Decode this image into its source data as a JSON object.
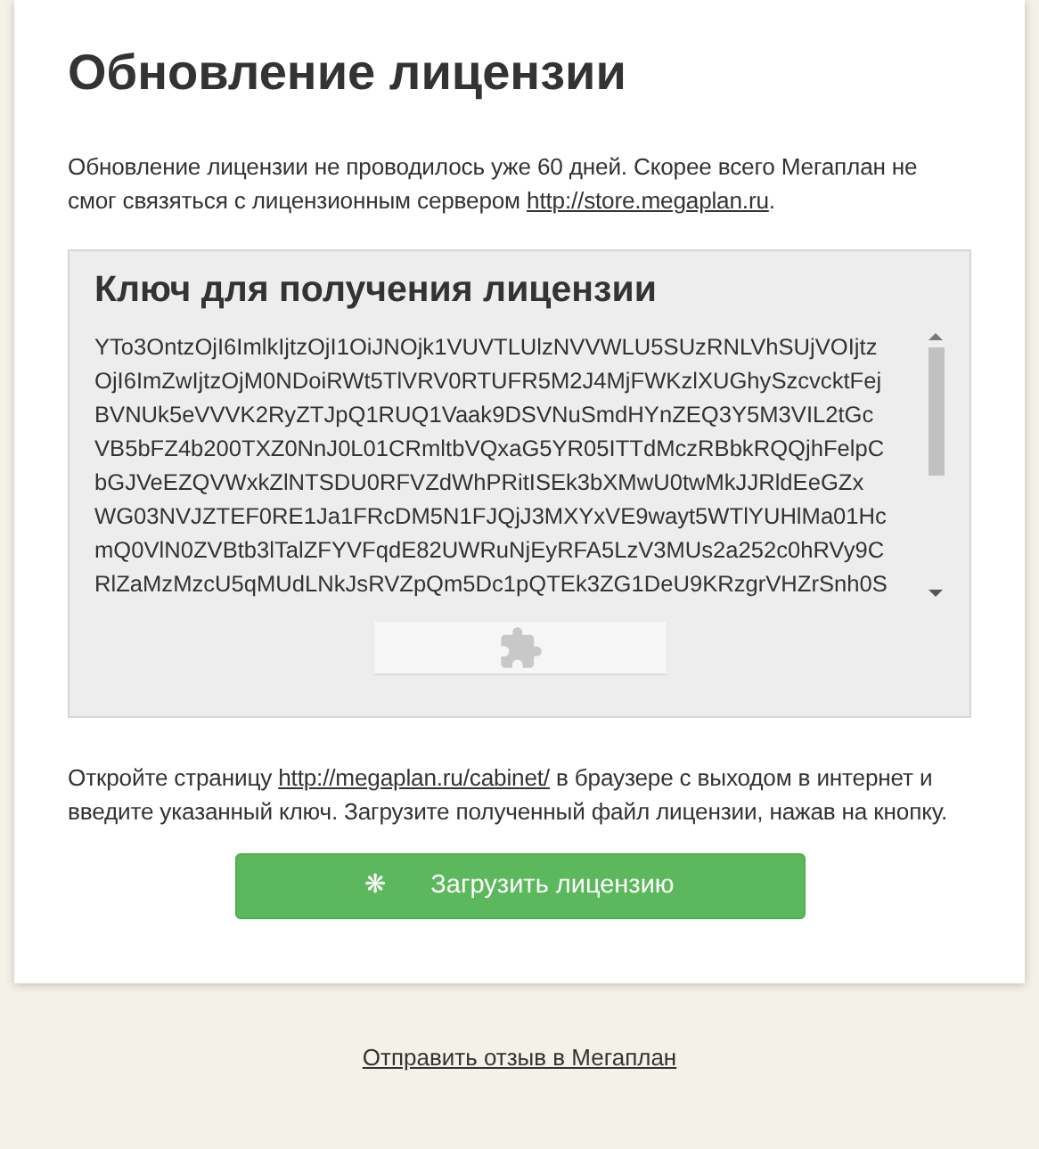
{
  "title": "Обновление лицензии",
  "intro": {
    "text": "Обновление лицензии не проводилось уже 60 дней. Скорее всего Мегаплан не смог связяться с лицензионным сервером ",
    "link": "http://store.megaplan.ru",
    "after": "."
  },
  "key_panel": {
    "heading": "Ключ для получения лицензии",
    "key_lines": [
      "YTo3OntzOjI6ImlkIjtzOjI1OiJNOjk1VUVTLUlzNVVWLU5SUzRNLVhSUjVOIjtz",
      "OjI6ImZwIjtzOjM0NDoiRWt5TlVRV0RTUFR5M2J4MjFWKzlXUGhySzcvcktFej",
      "BVNUk5eVVVK2RyZTJpQ1RUQ1Vaak9DSVNuSmdHYnZEQ3Y5M3VIL2tGc",
      "VB5bFZ4b200TXZ0NnJ0L01CRmltbVQxaG5YR05ITTdMczRBbkRQQjhFelpC",
      "bGJVeEZQVWxkZlNTSDU0RFVZdWhPRitISEk3bXMwU0twMkJJRldEeGZx",
      "WG03NVJZTEF0RE1Ja1FRcDM5N1FJQjJ3MXYxVE9wayt5WTlYUHlMa01Hc",
      "mQ0VlN0ZVBtb3lTalZFYVFqdE82UWRuNjEyRFA5LzV3MUs2a252c0hRVy9C",
      "RlZaMzMzcU5qMUdLNkJsRVZpQm5Dc1pQTEk3ZG1DeU9KRzgrVHZrSnh0S"
    ]
  },
  "instructions": {
    "before": "Откройте страницу ",
    "link": "http://megaplan.ru/cabinet/",
    "after": " в браузере с выходом в интернет и введите указанный ключ. Загрузите полученный файл лицензии, нажав на кнопку."
  },
  "upload_button": {
    "icon": "❋",
    "label": "Загрузить лицензию"
  },
  "feedback_link": "Отправить отзыв в Мегаплан"
}
